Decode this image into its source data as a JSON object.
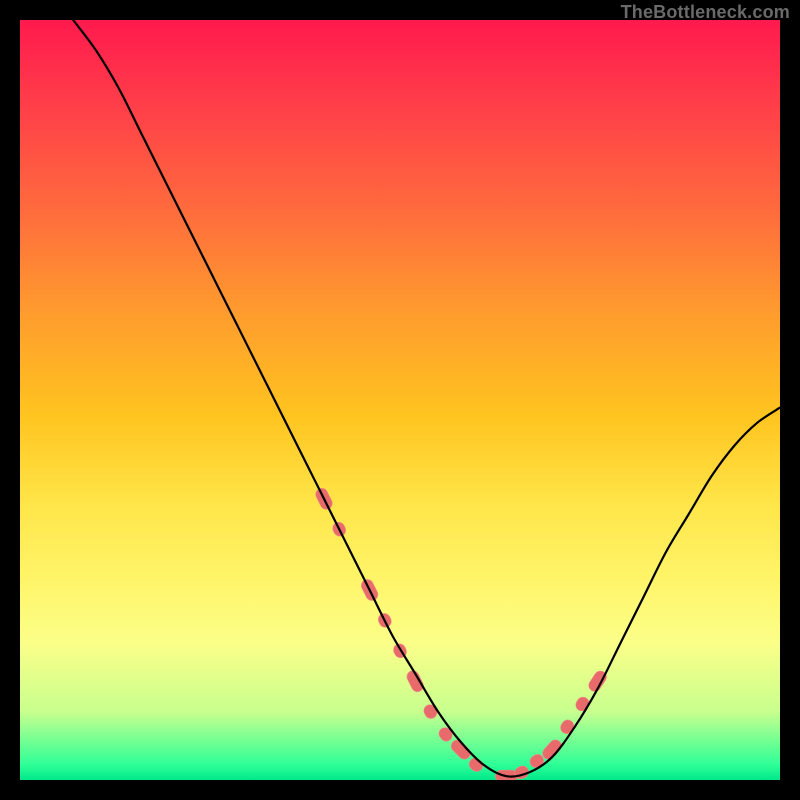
{
  "attribution": "TheBottleneck.com",
  "chart_data": {
    "type": "line",
    "title": "",
    "xlabel": "",
    "ylabel": "",
    "xlim": [
      0,
      100
    ],
    "ylim": [
      0,
      100
    ],
    "grid": false,
    "legend": false,
    "series": [
      {
        "name": "bottleneck-curve",
        "x": [
          7,
          10,
          13,
          16,
          19,
          22,
          25,
          28,
          31,
          34,
          37,
          40,
          43,
          46,
          49,
          52,
          55,
          58,
          61,
          64,
          67,
          70,
          73,
          76,
          79,
          82,
          85,
          88,
          91,
          94,
          97,
          100
        ],
        "y": [
          100,
          96,
          91,
          85,
          79,
          73,
          67,
          61,
          55,
          49,
          43,
          37,
          31,
          25,
          19,
          14,
          9,
          5,
          2,
          0.5,
          1,
          3,
          7,
          12,
          18,
          24,
          30,
          35,
          40,
          44,
          47,
          49
        ]
      }
    ],
    "markers": {
      "name": "highlighted-region",
      "x": [
        40,
        42,
        44,
        46,
        48,
        50,
        52,
        54,
        56,
        58,
        60,
        62,
        64,
        66,
        68,
        70,
        72,
        74,
        76
      ],
      "y": [
        37,
        33,
        29,
        25,
        21,
        17,
        13,
        9,
        6,
        4,
        2,
        1,
        0.5,
        1,
        2.5,
        4,
        7,
        10,
        13
      ]
    }
  },
  "colors": {
    "curve": "#000000",
    "marker": "#e86a6a",
    "background_top": "#ff1a4d",
    "background_bottom": "#00e889",
    "frame": "#000000"
  }
}
